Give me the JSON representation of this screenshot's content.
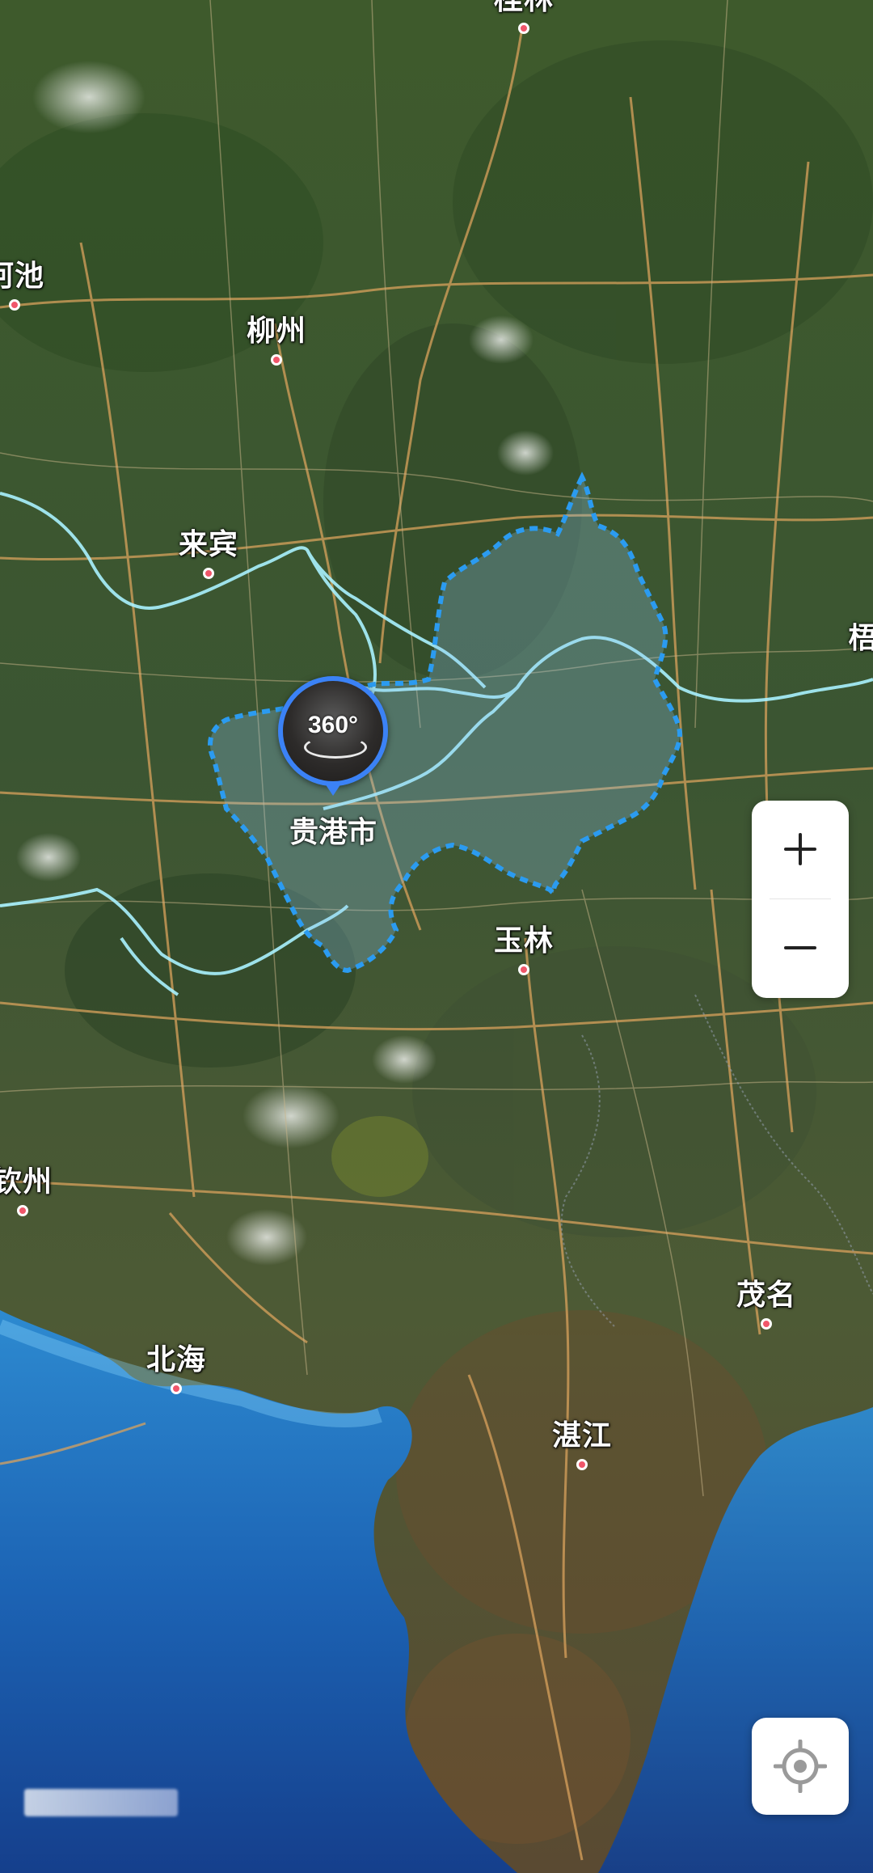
{
  "map": {
    "type": "satellite",
    "cities": [
      {
        "id": "guilin",
        "name": "桂林"
      },
      {
        "id": "hechi",
        "name": "河池"
      },
      {
        "id": "liuzhou",
        "name": "柳州"
      },
      {
        "id": "laibin",
        "name": "来宾"
      },
      {
        "id": "wuzhou",
        "name": "梧"
      },
      {
        "id": "yulin",
        "name": "玉林"
      },
      {
        "id": "qinzhou",
        "name": "钦州"
      },
      {
        "id": "beihai",
        "name": "北海"
      },
      {
        "id": "maoming",
        "name": "茂名"
      },
      {
        "id": "zhanjiang",
        "name": "湛江"
      }
    ],
    "selected_region": {
      "name": "贵港市"
    },
    "pin": {
      "text": "360°",
      "icon": "panorama-360-icon"
    },
    "colors": {
      "boundary": "#2b9bf0",
      "river": "#9ff4ff",
      "road": "#d9a25c",
      "ocean": "#1c5fb0",
      "land": "#3f5a2c",
      "city_dot": "#f0566a"
    }
  },
  "controls": {
    "zoom_in_label": "+",
    "zoom_out_label": "−",
    "zoom_in_icon": "plus-icon",
    "zoom_out_icon": "minus-icon",
    "locate_icon": "locate-crosshair-icon"
  }
}
